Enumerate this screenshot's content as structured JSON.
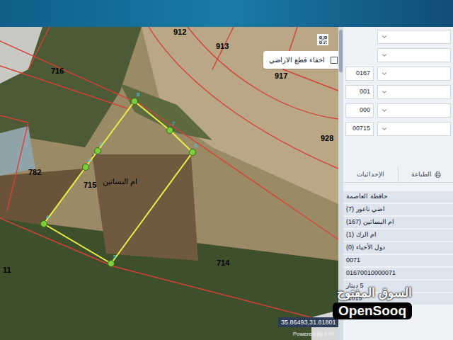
{
  "map": {
    "parcel_labels": [
      {
        "text": "912"
      },
      {
        "text": "913"
      },
      {
        "text": "917"
      },
      {
        "text": "928"
      },
      {
        "text": "716"
      },
      {
        "text": "782"
      },
      {
        "text": "715"
      },
      {
        "text": "714"
      },
      {
        "text": "11"
      }
    ],
    "area_label": "ام البساتين",
    "vertices": [
      {
        "text": "8"
      },
      {
        "text": "7"
      },
      {
        "text": "6"
      },
      {
        "text": "5"
      },
      {
        "text": "4"
      },
      {
        "text": "3"
      },
      {
        "text": "2"
      }
    ],
    "hide_parcels": {
      "label": "اخفاء قطع الاراضي",
      "checked": false
    },
    "coordinates": "35.86493,31.81801",
    "attribution": "Powered by Esri"
  },
  "panel": {
    "selects": [
      {
        "kind": "full",
        "code": ""
      },
      {
        "kind": "full",
        "code": ""
      },
      {
        "kind": "coded",
        "code": "0167"
      },
      {
        "kind": "coded",
        "code": "001"
      },
      {
        "kind": "coded",
        "code": "000"
      },
      {
        "kind": "coded",
        "code": "00715"
      }
    ],
    "tabs": [
      {
        "label": "الإحداثيات",
        "selected": false
      },
      {
        "label": "الطباعة",
        "selected": false
      }
    ],
    "rows": [
      {
        "text": "حافظة العاصمة"
      },
      {
        "text": "اضي ناعور (7)"
      },
      {
        "text": "ام البساتين (167)"
      },
      {
        "text": "ام الرك (1)"
      },
      {
        "text": "دول الأحياء (0)"
      },
      {
        "text": "0071"
      },
      {
        "text": "01670010000071"
      },
      {
        "text": "5 دينار"
      },
      {
        "text": "1015."
      }
    ]
  },
  "watermark": {
    "arabic": "السوق المفتوح",
    "latin": "OpenSooq"
  }
}
